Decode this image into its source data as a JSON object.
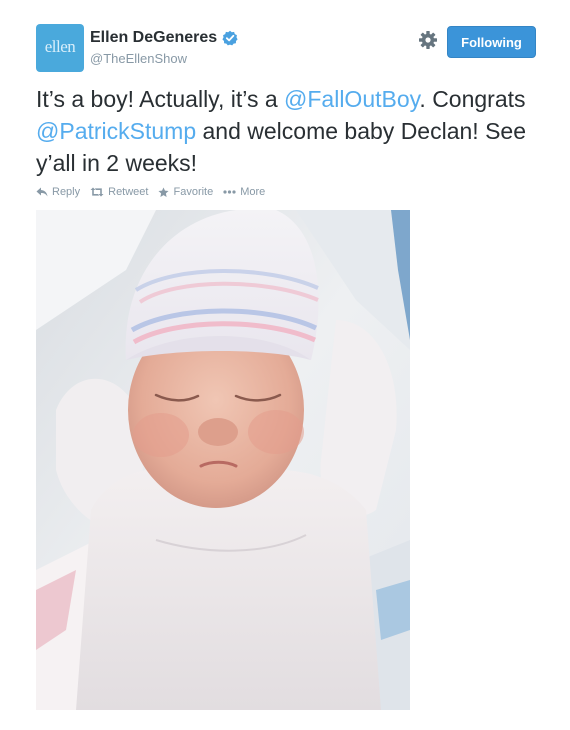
{
  "user": {
    "avatar_text": "ellen",
    "name": "Ellen DeGeneres",
    "handle": "@TheEllenShow",
    "verified": true
  },
  "follow_button": {
    "label": "Following"
  },
  "tweet": {
    "part1": "It’s a boy! Actually, it’s a ",
    "mention1": "@FallOutBoy",
    "part2": ". Congrats ",
    "mention2": "@PatrickStump",
    "part3": " and welcome baby Declan! See y’all in 2 weeks!"
  },
  "actions": [
    {
      "label": "Reply",
      "icon": "reply-icon"
    },
    {
      "label": "Retweet",
      "icon": "retweet-icon"
    },
    {
      "label": "Favorite",
      "icon": "star-icon"
    },
    {
      "label": "More",
      "icon": "more-icon"
    }
  ],
  "colors": {
    "link": "#55acee",
    "button": "#3b94d9",
    "muted": "#8899a6",
    "text": "#292f33"
  }
}
